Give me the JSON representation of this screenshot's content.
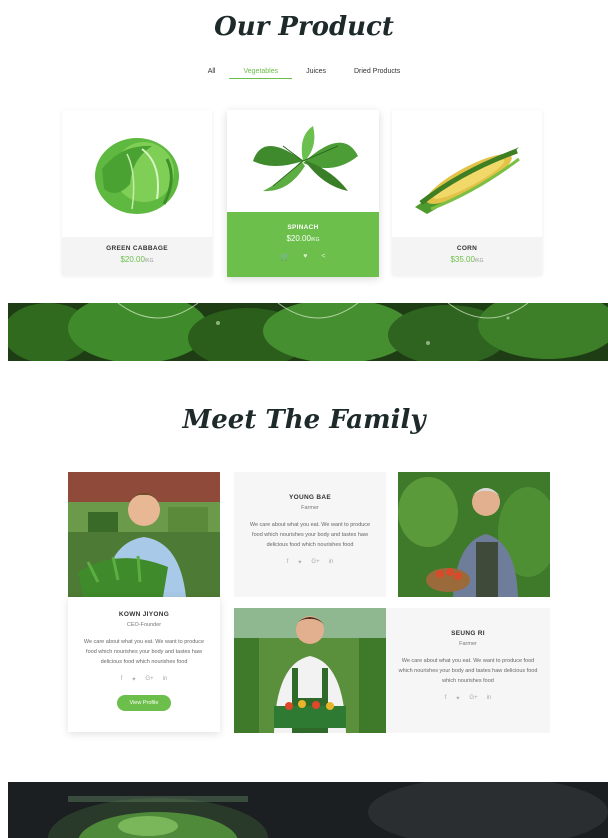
{
  "products_section": {
    "title": "Our Product",
    "filters": [
      "All",
      "Vegetables",
      "Juices",
      "Dried Products"
    ],
    "active_filter": "Vegetables",
    "products": [
      {
        "name": "GREEN CABBAGE",
        "price": "$20.00",
        "unit": "/KG"
      },
      {
        "name": "SPINACH",
        "price": "$20.00",
        "unit": "/KG"
      },
      {
        "name": "CORN",
        "price": "$35.00",
        "unit": "/KG"
      }
    ],
    "featured_actions": [
      "cart-icon",
      "heart-icon",
      "share-icon"
    ]
  },
  "family_section": {
    "title": "Meet The Family",
    "members": [
      {
        "name": "KOWN JIYONG",
        "role": "CEO-Founder",
        "desc": "We care about what you eat. We want to produce food which nourishes your body and tastes haw delicious food which nourishes food",
        "button": "View Profile"
      },
      {
        "name": "YOUNG BAE",
        "role": "Farmer",
        "desc": "We care about what you eat. We want to produce food which nourishes your body and tastes haw delicious food which nourishes food"
      },
      {
        "name": "SEUNG RI",
        "role": "Farmer",
        "desc": "We care about what you eat. We want to produce food which nourishes your body and tastes haw delicious food which nourishes food"
      }
    ],
    "social": [
      "f",
      "✦",
      "G+",
      "in"
    ]
  },
  "colors": {
    "accent": "#6cbf4a",
    "title": "#1e2a2a",
    "panel": "#f6f6f6"
  }
}
